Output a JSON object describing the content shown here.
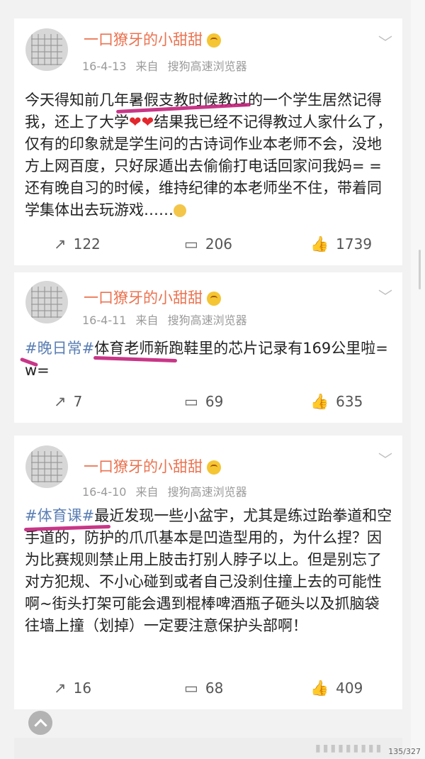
{
  "posts": [
    {
      "username": "一口獠牙的小甜甜",
      "date": "16-4-13",
      "source_prefix": "来自",
      "source": "搜狗高速浏览器",
      "text_1": "今天得知前几年暑假支教时候教过的一个学生居然记得我，还上了大学",
      "hearts": "❤❤",
      "text_2": "结果我已经不记得教过人家什么了，仅有的印象就是学生问的古诗词作业本老师不会，没地方上网百度，只好尿遁出去偷偷打电话回家问我妈= =还有晚自习的时候，维持纪律的本老师坐不住，带着同学集体出去玩游戏……",
      "repost_count": "122",
      "comment_count": "206",
      "like_count": "1739"
    },
    {
      "username": "一口獠牙的小甜甜",
      "date": "16-4-11",
      "source_prefix": "来自",
      "source": "搜狗高速浏览器",
      "hashtag": "#晚日常#",
      "text": "体育老师新跑鞋里的芯片记录有169公里啦=w=",
      "repost_count": "7",
      "comment_count": "69",
      "like_count": "635"
    },
    {
      "username": "一口獠牙的小甜甜",
      "date": "16-4-10",
      "source_prefix": "来自",
      "source": "搜狗高速浏览器",
      "hashtag": "#体育课#",
      "text": "最近发现一些小盆宇，尤其是练过跆拳道和空手道的，防护的爪爪基本是凹造型用的，为什么捏？因为比赛规则禁止用上肢击打别人脖子以上。但是别忘了对方犯规、不小心碰到或者自己没刹住撞上去的可能性啊~街头打架可能会遇到棍棒啤酒瓶子砸头以及抓脑袋往墙上撞（划掉）一定要注意保护头部啊！",
      "repost_count": "16",
      "comment_count": "68",
      "like_count": "409"
    }
  ],
  "page_counter": "135/327",
  "colors": {
    "username": "#eb7350",
    "hashtag": "#5b7fb4",
    "underline": "#c2207a"
  },
  "icons": {
    "repost": "repost-icon",
    "comment": "comment-icon",
    "like": "like-icon",
    "more": "chevron-down-icon"
  }
}
